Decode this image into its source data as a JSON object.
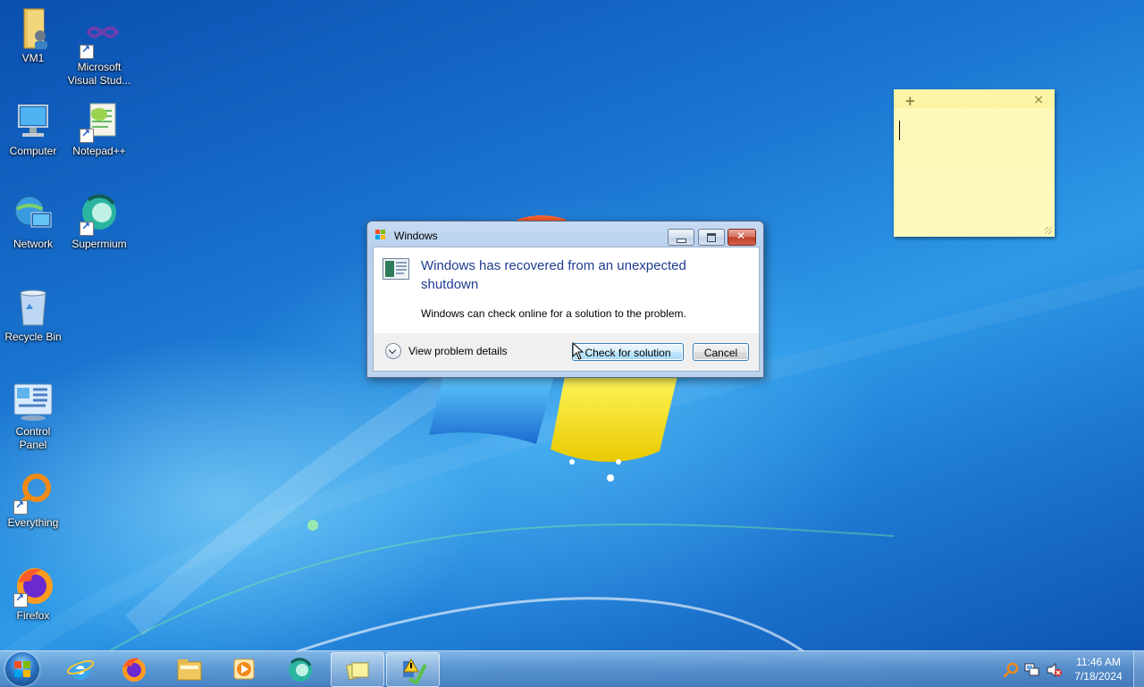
{
  "desktop": {
    "icons": [
      {
        "label": "VM1"
      },
      {
        "label": "Microsoft Visual Stud..."
      },
      {
        "label": "Computer"
      },
      {
        "label": "Notepad++"
      },
      {
        "label": "Network"
      },
      {
        "label": "Supermium"
      },
      {
        "label": "Recycle Bin"
      },
      {
        "label": "Control Panel"
      },
      {
        "label": "Everything"
      },
      {
        "label": "Firefox"
      }
    ]
  },
  "sticky_note": {
    "add_glyph": "+",
    "close_glyph": "×",
    "text": ""
  },
  "dialog": {
    "title": "Windows",
    "main_instruction": "Windows has recovered from an unexpected shutdown",
    "content": "Windows can check online for a solution to the problem.",
    "details_label": "View problem details",
    "check_button": "Check for solution",
    "cancel_button": "Cancel"
  },
  "taskbar": {
    "pinned": [
      "internet-explorer",
      "firefox",
      "file-explorer",
      "media-player",
      "supermium",
      "sticky-notes",
      "action-center"
    ],
    "clock": {
      "time": "11:46 AM",
      "date": "7/18/2024"
    }
  }
}
